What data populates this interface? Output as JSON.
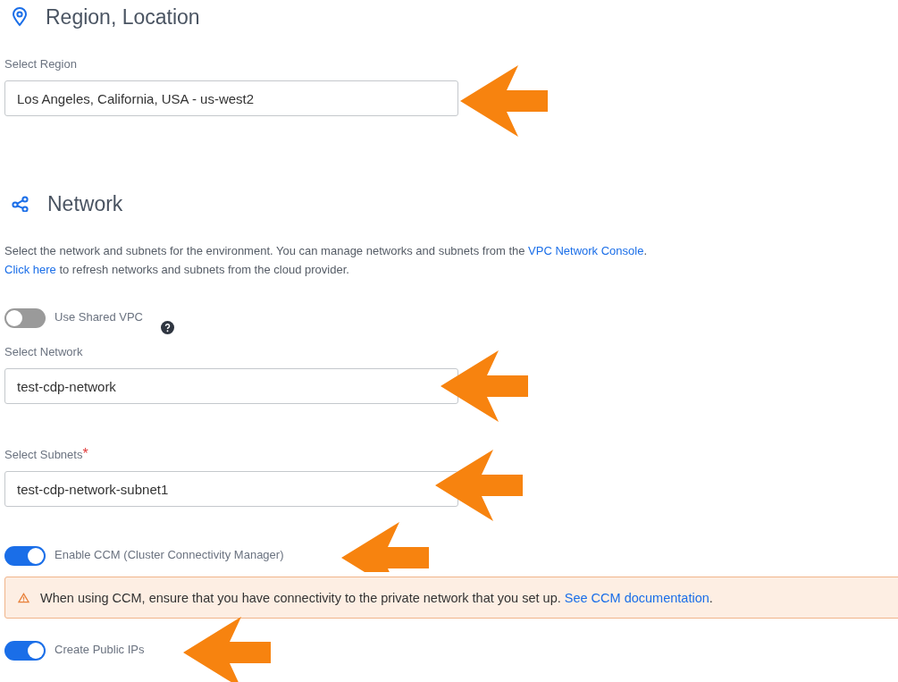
{
  "region": {
    "title": "Region, Location",
    "field": {
      "label": "Select Region",
      "value": "Los Angeles, California, USA - us-west2"
    }
  },
  "network": {
    "title": "Network",
    "description": [
      [
        {
          "kind": "text",
          "text": "Select the network and subnets for the environment. You can manage networks and subnets from the "
        },
        {
          "kind": "link",
          "text": "VPC Network Console"
        },
        {
          "kind": "text",
          "text": "."
        }
      ],
      [
        {
          "kind": "link",
          "text": "Click here"
        },
        {
          "kind": "text",
          "text": " to refresh networks and subnets from the cloud provider."
        }
      ]
    ],
    "items": [
      {
        "kind": "toggle",
        "label": "Use Shared VPC",
        "on": false,
        "help": true
      },
      {
        "kind": "field",
        "label": "Select Network",
        "value": "test-cdp-network"
      },
      {
        "kind": "field",
        "label": "Select Subnets",
        "required": "*",
        "value": "test-cdp-network-subnet1"
      },
      {
        "kind": "toggle",
        "label": "Enable CCM (Cluster Connectivity Manager)",
        "on": true
      },
      {
        "kind": "alert",
        "parts": [
          {
            "kind": "text",
            "text": "When using CCM, ensure that you have connectivity to the private network that you set up. "
          },
          {
            "kind": "link",
            "text": "See CCM documentation"
          },
          {
            "kind": "text",
            "text": "."
          }
        ]
      },
      {
        "kind": "toggle",
        "label": "Create Public IPs",
        "on": true
      }
    ]
  }
}
